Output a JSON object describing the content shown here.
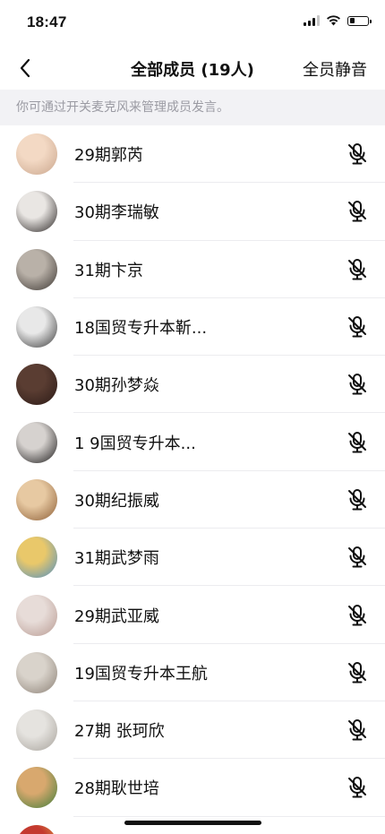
{
  "status_bar": {
    "time": "18:47",
    "battery_level": 0.3,
    "signal_bars": 3
  },
  "nav": {
    "title": "全部成员 (19人)",
    "mute_all_label": "全员静音",
    "back_icon": "chevron-left-icon"
  },
  "hint": "你可通过开关麦克风来管理成员发言。",
  "members": [
    {
      "name": "29期郭芮",
      "avatar_colors": [
        "#f3d9c4",
        "#c9a58c"
      ],
      "mic_icon": "mic-off-icon"
    },
    {
      "name": "30期李瑞敏",
      "avatar_colors": [
        "#e9e6e3",
        "#2a2524"
      ],
      "mic_icon": "mic-off-icon"
    },
    {
      "name": "31期卞京",
      "avatar_colors": [
        "#b9b1a8",
        "#3b3531"
      ],
      "mic_icon": "mic-off-icon"
    },
    {
      "name": "18国贸专升本靳...",
      "avatar_colors": [
        "#e8e8e8",
        "#3a3a3a"
      ],
      "mic_icon": "mic-off-icon"
    },
    {
      "name": "30期孙梦焱",
      "avatar_colors": [
        "#5a3d32",
        "#2b1a16"
      ],
      "mic_icon": "mic-off-icon"
    },
    {
      "name": "1 9国贸专升本...",
      "avatar_colors": [
        "#d6d2cf",
        "#1c1a1a"
      ],
      "mic_icon": "mic-off-icon"
    },
    {
      "name": "30期纪振威",
      "avatar_colors": [
        "#e7c9a2",
        "#8c5d35"
      ],
      "mic_icon": "mic-off-icon"
    },
    {
      "name": "31期武梦雨",
      "avatar_colors": [
        "#e9c86a",
        "#4f8fc2"
      ],
      "mic_icon": "mic-off-icon"
    },
    {
      "name": "29期武亚威",
      "avatar_colors": [
        "#e7dcd8",
        "#b89a92"
      ],
      "mic_icon": "mic-off-icon"
    },
    {
      "name": "19国贸专升本王航",
      "avatar_colors": [
        "#d9d3cb",
        "#8c8176"
      ],
      "mic_icon": "mic-off-icon"
    },
    {
      "name": "27期 张珂欣",
      "avatar_colors": [
        "#e5e3df",
        "#a7a29b"
      ],
      "mic_icon": "mic-off-icon"
    },
    {
      "name": "28期耿世培",
      "avatar_colors": [
        "#d8a86e",
        "#3f7d3a"
      ],
      "mic_icon": "mic-off-icon"
    },
    {
      "name": "",
      "avatar_colors": [
        "#c4392f",
        "#e0b44b"
      ],
      "mic_icon": "mic-off-icon"
    }
  ]
}
